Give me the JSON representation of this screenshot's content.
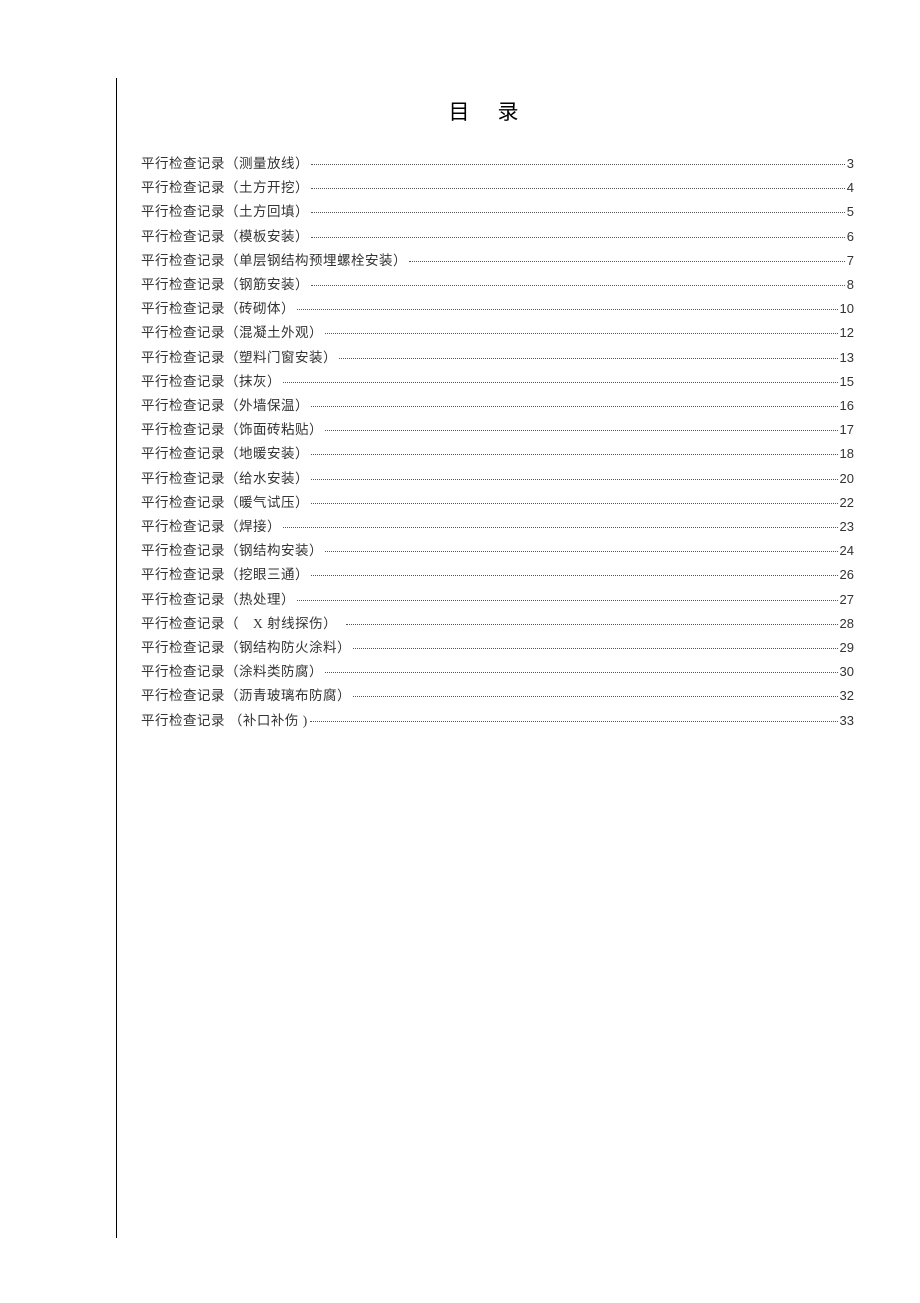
{
  "title": "目录",
  "toc": [
    {
      "label": "平行检查记录（测量放线）",
      "page": "3"
    },
    {
      "label": "平行检查记录（土方开挖）",
      "page": "4"
    },
    {
      "label": "平行检查记录（土方回填）",
      "page": "5"
    },
    {
      "label": "平行检查记录（模板安装）",
      "page": "6"
    },
    {
      "label": "平行检查记录（单层钢结构预埋螺栓安装）",
      "page": "7"
    },
    {
      "label": "平行检查记录（钢筋安装）",
      "page": "8"
    },
    {
      "label": "平行检查记录（砖砌体）",
      "page": "10"
    },
    {
      "label": "平行检查记录（混凝土外观）",
      "page": "12"
    },
    {
      "label": "平行检查记录（塑料门窗安装）",
      "page": "13"
    },
    {
      "label": "平行检查记录（抹灰）",
      "page": "15"
    },
    {
      "label": "平行检查记录（外墙保温）",
      "page": "16"
    },
    {
      "label": "平行检查记录（饰面砖粘贴）",
      "page": "17"
    },
    {
      "label": "平行检查记录（地暖安装）",
      "page": "18"
    },
    {
      "label": "平行检查记录（给水安装）",
      "page": "20"
    },
    {
      "label": "平行检查记录（暖气试压）",
      "page": "22"
    },
    {
      "label": "平行检查记录（焊接）",
      "page": "23"
    },
    {
      "label": "平行检查记录（钢结构安装）",
      "page": "24"
    },
    {
      "label": "平行检查记录（挖眼三通）",
      "page": "26"
    },
    {
      "label": "平行检查记录（热处理）",
      "page": "27"
    },
    {
      "label": "平行检查记录（　X 射线探伤）　",
      "page": "28"
    },
    {
      "label": "平行检查记录（钢结构防火涂料）",
      "page": "29"
    },
    {
      "label": "平行检查记录（涂料类防腐）",
      "page": "30"
    },
    {
      "label": "平行检查记录（沥青玻璃布防腐）",
      "page": "32"
    },
    {
      "label": "平行检查记录 （补口补伤 )",
      "page": "33"
    }
  ]
}
